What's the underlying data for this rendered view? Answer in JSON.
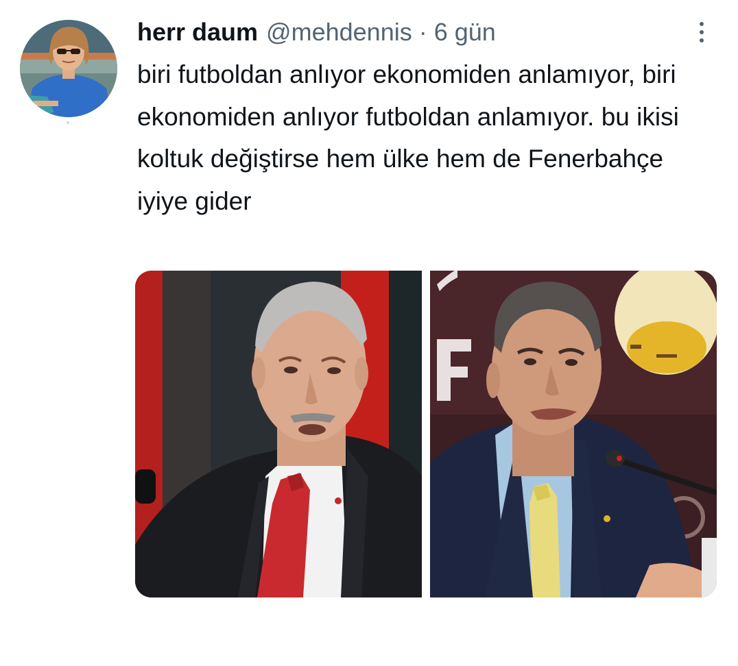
{
  "tweet": {
    "author": {
      "display_name": "herr daum",
      "handle": "@mehdennis",
      "avatar_icon": "user-avatar-icon"
    },
    "separator": "·",
    "time": "6 gün",
    "more_icon": "more-options-icon",
    "text": "biri futboldan anlıyor ekonomiden anlamıyor, biri ekonomiden anlıyor futboldan anlamıyor. bu ikisi koltuk değiştirse hem ülke hem de Fenerbahçe iyiye gider",
    "media": [
      {
        "icon": "photo-man-red-tie-icon"
      },
      {
        "icon": "photo-man-yellow-tie-microphone-icon"
      }
    ]
  },
  "colors": {
    "text_primary": "#0f1419",
    "text_secondary": "#536471",
    "background": "#ffffff"
  }
}
